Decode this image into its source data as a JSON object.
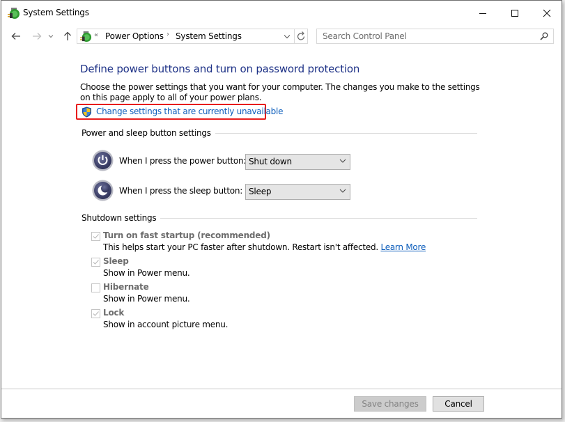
{
  "window": {
    "title": "System Settings",
    "controls": {
      "minimize": "minimize",
      "maximize": "maximize",
      "close": "close"
    }
  },
  "nav": {
    "back": "back",
    "forward": "forward",
    "recent": "recent-locations",
    "up": "up"
  },
  "address": {
    "overflow": "«",
    "breadcrumbs": [
      {
        "label": "Power Options"
      },
      {
        "label": "System Settings"
      }
    ],
    "separator": "›"
  },
  "search": {
    "placeholder": "Search Control Panel"
  },
  "main": {
    "heading": "Define power buttons and turn on password protection",
    "description": "Choose the power settings that you want for your computer. The changes you make to the settings on this page apply to all of your power plans.",
    "change_link": "Change settings that are currently unavailable",
    "highlight_color": "#e81c1c",
    "power_section": {
      "label": "Power and sleep button settings",
      "rows": [
        {
          "label": "When I press the power button:",
          "value": "Shut down",
          "icon": "power-icon"
        },
        {
          "label": "When I press the sleep button:",
          "value": "Sleep",
          "icon": "sleep-icon"
        }
      ]
    },
    "shutdown_section": {
      "label": "Shutdown settings",
      "items": [
        {
          "label": "Turn on fast startup (recommended)",
          "checked": true,
          "desc": "This helps start your PC faster after shutdown. Restart isn't affected.",
          "link": "Learn More"
        },
        {
          "label": "Sleep",
          "checked": true,
          "desc": "Show in Power menu."
        },
        {
          "label": "Hibernate",
          "checked": false,
          "desc": "Show in Power menu."
        },
        {
          "label": "Lock",
          "checked": true,
          "desc": "Show in account picture menu."
        }
      ]
    }
  },
  "footer": {
    "save": "Save changes",
    "cancel": "Cancel"
  }
}
